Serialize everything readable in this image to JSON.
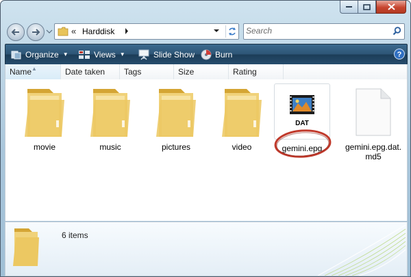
{
  "window": {
    "title": ""
  },
  "address": {
    "folder": "Harddisk",
    "chevron": "«"
  },
  "search": {
    "placeholder": "Search"
  },
  "toolbar": {
    "organize": "Organize",
    "views": "Views",
    "slideshow": "Slide Show",
    "burn": "Burn"
  },
  "columns": [
    "Name",
    "Date taken",
    "Tags",
    "Size",
    "Rating"
  ],
  "items": [
    {
      "label": "movie",
      "type": "folder"
    },
    {
      "label": "music",
      "type": "folder"
    },
    {
      "label": "pictures",
      "type": "folder"
    },
    {
      "label": "video",
      "type": "folder"
    },
    {
      "label": "gemini.epg",
      "type": "dat-file",
      "badge": "DAT"
    },
    {
      "label": "gemini.epg.dat.\nmd5",
      "label_line1": "gemini.epg.dat.",
      "label_line2": "md5",
      "type": "blank-file"
    }
  ],
  "details": {
    "count": "6 items"
  },
  "colors": {
    "commandbar": "#2d5576",
    "highlight_ring": "#c0392b"
  }
}
